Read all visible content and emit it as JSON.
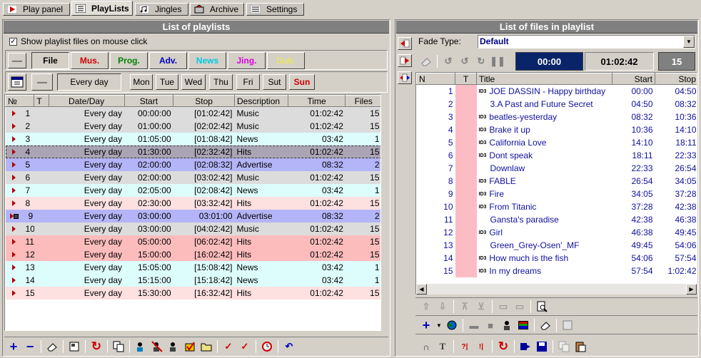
{
  "tabs": [
    {
      "label": "Play panel",
      "icon": "play-icon"
    },
    {
      "label": "PlayLists",
      "icon": "playlists-icon"
    },
    {
      "label": "Jingles",
      "icon": "jingles-icon"
    },
    {
      "label": "Archive",
      "icon": "archive-icon"
    },
    {
      "label": "Settings",
      "icon": "settings-icon"
    }
  ],
  "left": {
    "title": "List of playlists",
    "show_files_label": "Show playlist files on mouse click",
    "filters": [
      {
        "label": "File",
        "color": "#000000"
      },
      {
        "label": "Mus.",
        "color": "#d00000"
      },
      {
        "label": "Prog.",
        "color": "#008000"
      },
      {
        "label": "Adv.",
        "color": "#0000c0"
      },
      {
        "label": "News",
        "color": "#00c8e0"
      },
      {
        "label": "Jing.",
        "color": "#e000e0"
      },
      {
        "label": "Dub.",
        "color": "#e8e860"
      }
    ],
    "every_day": "Every day",
    "days": [
      {
        "label": "Mon",
        "color": "#000000"
      },
      {
        "label": "Tue",
        "color": "#000000"
      },
      {
        "label": "Wed",
        "color": "#000000"
      },
      {
        "label": "Thu",
        "color": "#000000"
      },
      {
        "label": "Fri",
        "color": "#000000"
      },
      {
        "label": "Sut",
        "color": "#000000"
      },
      {
        "label": "Sun",
        "color": "#d00000"
      }
    ],
    "columns": [
      "№",
      "T",
      "Date/Day",
      "Start",
      "Stop",
      "Description",
      "Time",
      "Files"
    ],
    "rows": [
      {
        "n": "1",
        "day": "Every day",
        "start": "00:00:00",
        "stop": "[01:02:42]",
        "desc": "Music",
        "time": "01:02:42",
        "files": "15",
        "cls": "r-music"
      },
      {
        "n": "2",
        "day": "Every day",
        "start": "01:00:00",
        "stop": "[02:02:42]",
        "desc": "Music",
        "time": "01:02:42",
        "files": "15",
        "cls": "r-music"
      },
      {
        "n": "3",
        "day": "Every day",
        "start": "01:05:00",
        "stop": "[01:08:42]",
        "desc": "News",
        "time": "03:42",
        "files": "1",
        "cls": "r-news"
      },
      {
        "n": "4",
        "day": "Every day",
        "start": "01:30:00",
        "stop": "[02:32:42]",
        "desc": "Hits",
        "time": "01:02:42",
        "files": "15",
        "cls": "r-sel"
      },
      {
        "n": "5",
        "day": "Every day",
        "start": "02:00:00",
        "stop": "[02:08:32]",
        "desc": "Advertise",
        "time": "08:32",
        "files": "2",
        "cls": "r-adv"
      },
      {
        "n": "6",
        "day": "Every day",
        "start": "02:00:00",
        "stop": "[03:02:42]",
        "desc": "Music",
        "time": "01:02:42",
        "files": "15",
        "cls": "r-music"
      },
      {
        "n": "7",
        "day": "Every day",
        "start": "02:05:00",
        "stop": "[02:08:42]",
        "desc": "News",
        "time": "03:42",
        "files": "1",
        "cls": "r-news"
      },
      {
        "n": "8",
        "day": "Every day",
        "start": "02:30:00",
        "stop": "[03:32:42]",
        "desc": "Hits",
        "time": "01:02:42",
        "files": "15",
        "cls": "r-hits"
      },
      {
        "n": "9",
        "day": "Every day",
        "start": "03:00:00",
        "stop": "03:01:00",
        "desc": "Advertise",
        "time": "08:32",
        "files": "2",
        "cls": "r-adv",
        "playing": true
      },
      {
        "n": "10",
        "day": "Every day",
        "start": "03:00:00",
        "stop": "[04:02:42]",
        "desc": "Music",
        "time": "01:02:42",
        "files": "15",
        "cls": "r-music"
      },
      {
        "n": "11",
        "day": "Every day",
        "start": "05:00:00",
        "stop": "[06:02:42]",
        "desc": "Hits",
        "time": "01:02:42",
        "files": "15",
        "cls": "r-hitsd"
      },
      {
        "n": "12",
        "day": "Every day",
        "start": "15:00:00",
        "stop": "[16:02:42]",
        "desc": "Hits",
        "time": "01:02:42",
        "files": "15",
        "cls": "r-hitsd"
      },
      {
        "n": "13",
        "day": "Every day",
        "start": "15:05:00",
        "stop": "[15:08:42]",
        "desc": "News",
        "time": "03:42",
        "files": "1",
        "cls": "r-news"
      },
      {
        "n": "14",
        "day": "Every day",
        "start": "15:15:00",
        "stop": "[15:18:42]",
        "desc": "News",
        "time": "03:42",
        "files": "1",
        "cls": "r-news"
      },
      {
        "n": "15",
        "day": "Every day",
        "start": "15:30:00",
        "stop": "[16:32:42]",
        "desc": "Hits",
        "time": "01:02:42",
        "files": "15",
        "cls": "r-hits"
      }
    ]
  },
  "right": {
    "title": "List of files in playlist",
    "fade_label": "Fade Type:",
    "fade_value": "Default",
    "pos_time": "00:00",
    "total_time": "01:02:42",
    "count": "15",
    "columns": [
      "N",
      "T",
      "Title",
      "Start",
      "Stop"
    ],
    "rows": [
      {
        "n": "1",
        "title": "JOE DASSIN - Happy birthday",
        "id3": true,
        "start": "00:00",
        "stop": "04:50"
      },
      {
        "n": "2",
        "title": "3.A Past and Future Secret",
        "id3": false,
        "start": "04:50",
        "stop": "08:32"
      },
      {
        "n": "3",
        "title": "beatles-yesterday",
        "id3": true,
        "start": "08:32",
        "stop": "10:36"
      },
      {
        "n": "4",
        "title": "Brake it up",
        "id3": true,
        "start": "10:36",
        "stop": "14:10"
      },
      {
        "n": "5",
        "title": "California Love",
        "id3": true,
        "start": "14:10",
        "stop": "18:11"
      },
      {
        "n": "6",
        "title": "Dont speak",
        "id3": true,
        "start": "18:11",
        "stop": "22:33"
      },
      {
        "n": "7",
        "title": "Downlaw",
        "id3": false,
        "start": "22:33",
        "stop": "26:54"
      },
      {
        "n": "8",
        "title": "FABLE",
        "id3": true,
        "start": "26:54",
        "stop": "34:05"
      },
      {
        "n": "9",
        "title": "Fire",
        "id3": true,
        "start": "34:05",
        "stop": "37:28"
      },
      {
        "n": "10",
        "title": "From Titanic",
        "id3": true,
        "start": "37:28",
        "stop": "42:38"
      },
      {
        "n": "11",
        "title": "Gansta's paradise",
        "id3": false,
        "start": "42:38",
        "stop": "46:38"
      },
      {
        "n": "12",
        "title": "Girl",
        "id3": true,
        "start": "46:38",
        "stop": "49:45"
      },
      {
        "n": "13",
        "title": "Green_Grey-Osen'_MF",
        "id3": false,
        "start": "49:45",
        "stop": "54:06"
      },
      {
        "n": "14",
        "title": "How much is the fish",
        "id3": true,
        "start": "54:06",
        "stop": "57:54"
      },
      {
        "n": "15",
        "title": "In my dreams",
        "id3": true,
        "start": "57:54",
        "stop": "1:02:42"
      }
    ]
  },
  "id3_label": "ID3"
}
